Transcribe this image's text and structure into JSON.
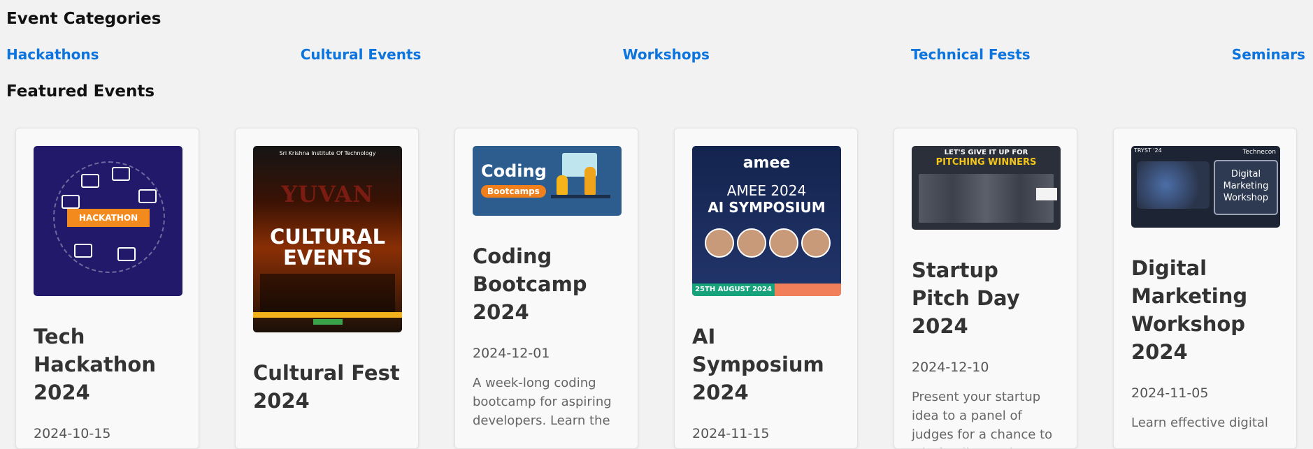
{
  "event_categories": {
    "title": "Event Categories",
    "items": [
      "Hackathons",
      "Cultural Events",
      "Workshops",
      "Technical Fests",
      "Seminars"
    ]
  },
  "featured_events": {
    "title": "Featured Events",
    "cards": [
      {
        "title": "Tech Hackathon 2024",
        "date": "2024-10-15",
        "description": "",
        "poster": {
          "banner": "HACKATHON"
        }
      },
      {
        "title": "Cultural Fest 2024",
        "date": "",
        "description": "",
        "poster": {
          "name": "YUVAN",
          "headline": "CULTURAL EVENTS",
          "institute": "Sri Krishna Institute Of Technology"
        }
      },
      {
        "title": "Coding Bootcamp 2024",
        "date": "2024-12-01",
        "description": "A week-long coding bootcamp for aspiring developers. Learn the",
        "poster": {
          "line1": "Coding",
          "line2": "Bootcamps"
        }
      },
      {
        "title": "AI Symposium 2024",
        "date": "2024-11-15",
        "description": "",
        "poster": {
          "logo": "amee",
          "line1": "AMEE 2024",
          "line2": "AI SYMPOSIUM",
          "footer": "25TH AUGUST 2024"
        }
      },
      {
        "title": "Startup Pitch Day 2024",
        "date": "2024-12-10",
        "description": "Present your startup idea to a panel of judges for a chance to win funding and",
        "poster": {
          "line1": "LET'S GIVE IT UP FOR",
          "line2": "PITCHING WINNERS"
        }
      },
      {
        "title": "Digital Marketing Workshop 2024",
        "date": "2024-11-05",
        "description": "Learn effective digital",
        "poster": {
          "text": "Digital Marketing Workshop",
          "corner_left": "TRYST '24",
          "corner_right": "Technecon"
        }
      }
    ]
  },
  "colors": {
    "link": "#0b74de",
    "background": "#f2f2f2",
    "card": "#f9f9f9"
  }
}
